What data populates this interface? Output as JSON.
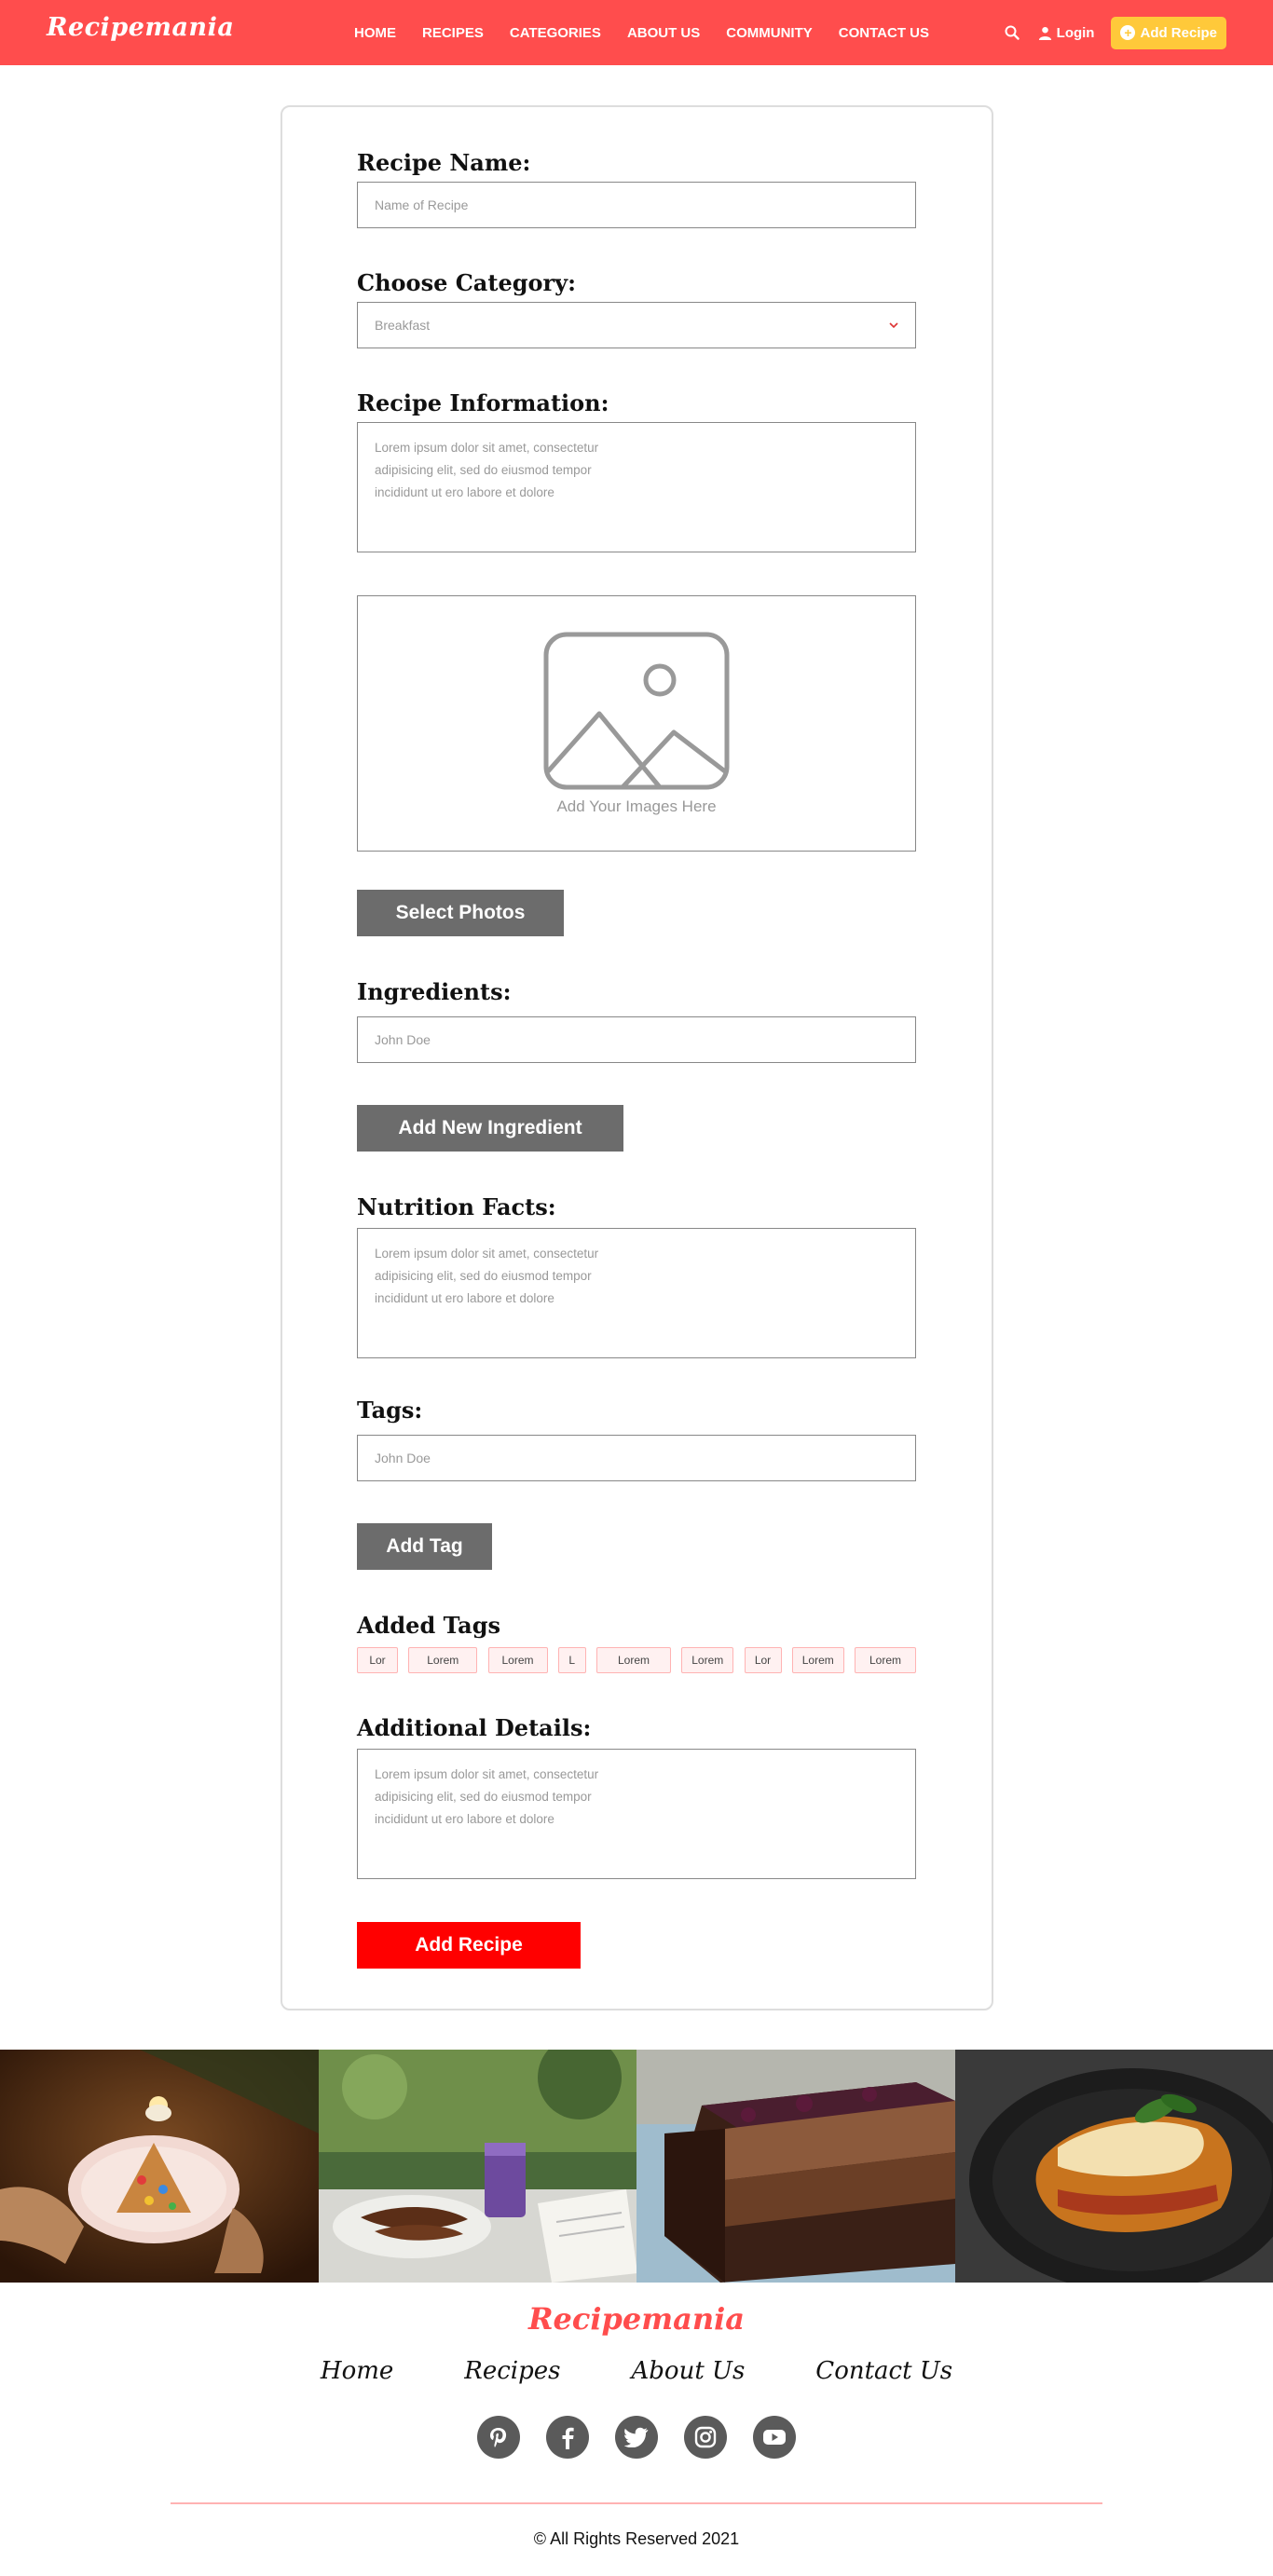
{
  "brand": {
    "name": "Recipemania",
    "primary_color": "#ff4d4d",
    "accent_color": "#ffc93a"
  },
  "nav": {
    "links": [
      "HOME",
      "RECIPES",
      "CATEGORIES",
      "ABOUT US",
      "COMMUNITY",
      "CONTACT US"
    ],
    "login_label": "Login",
    "add_recipe_label": "Add Recipe",
    "icons": {
      "search": "search-icon",
      "login": "user-icon",
      "add": "plus-circle-icon"
    }
  },
  "form": {
    "recipe_name": {
      "label": "Recipe Name:",
      "placeholder": "Name of Recipe"
    },
    "category": {
      "label": "Choose Category:",
      "selected": "Breakfast"
    },
    "recipe_info": {
      "label": "Recipe Information:",
      "placeholder": "Lorem ipsum dolor sit amet, consectetur\nadipisicing elit, sed do eiusmod tempor\nincididunt ut ero labore et dolore"
    },
    "images": {
      "upload_text": "Add Your Images Here",
      "select_button": "Select Photos"
    },
    "ingredients": {
      "label": "Ingredients:",
      "placeholder": "John Doe",
      "add_button": "Add New Ingredient"
    },
    "nutrition": {
      "label": "Nutrition Facts:",
      "placeholder": "Lorem ipsum dolor sit amet, consectetur\nadipisicing elit, sed do eiusmod tempor\nincididunt ut ero labore et dolore"
    },
    "tags": {
      "label": "Tags:",
      "placeholder": "John Doe",
      "add_button": "Add Tag"
    },
    "added_tags": {
      "label": "Added Tags",
      "items": [
        "Lor",
        "Lorem",
        "Lorem",
        "L",
        "Lorem",
        "Lorem",
        "Lor",
        "Lorem",
        "Lorem"
      ]
    },
    "additional": {
      "label": "Additional Details:",
      "placeholder": "Lorem ipsum dolor sit amet, consectetur\nadipisicing elit, sed do eiusmod tempor\nincididunt ut ero labore et dolore"
    },
    "submit_label": "Add Recipe"
  },
  "gallery": {
    "photos": [
      "gingerbread-cookies-photo",
      "grilled-meat-smoothie-photo",
      "chocolate-cake-photo",
      "lasagna-photo"
    ]
  },
  "footer": {
    "logo": "Recipemania",
    "links": [
      "Home",
      "Recipes",
      "About Us",
      "Contact Us"
    ],
    "socials": [
      "pinterest-icon",
      "facebook-icon",
      "twitter-icon",
      "instagram-icon",
      "youtube-icon"
    ],
    "copyright": "© All Rights Reserved 2021"
  }
}
